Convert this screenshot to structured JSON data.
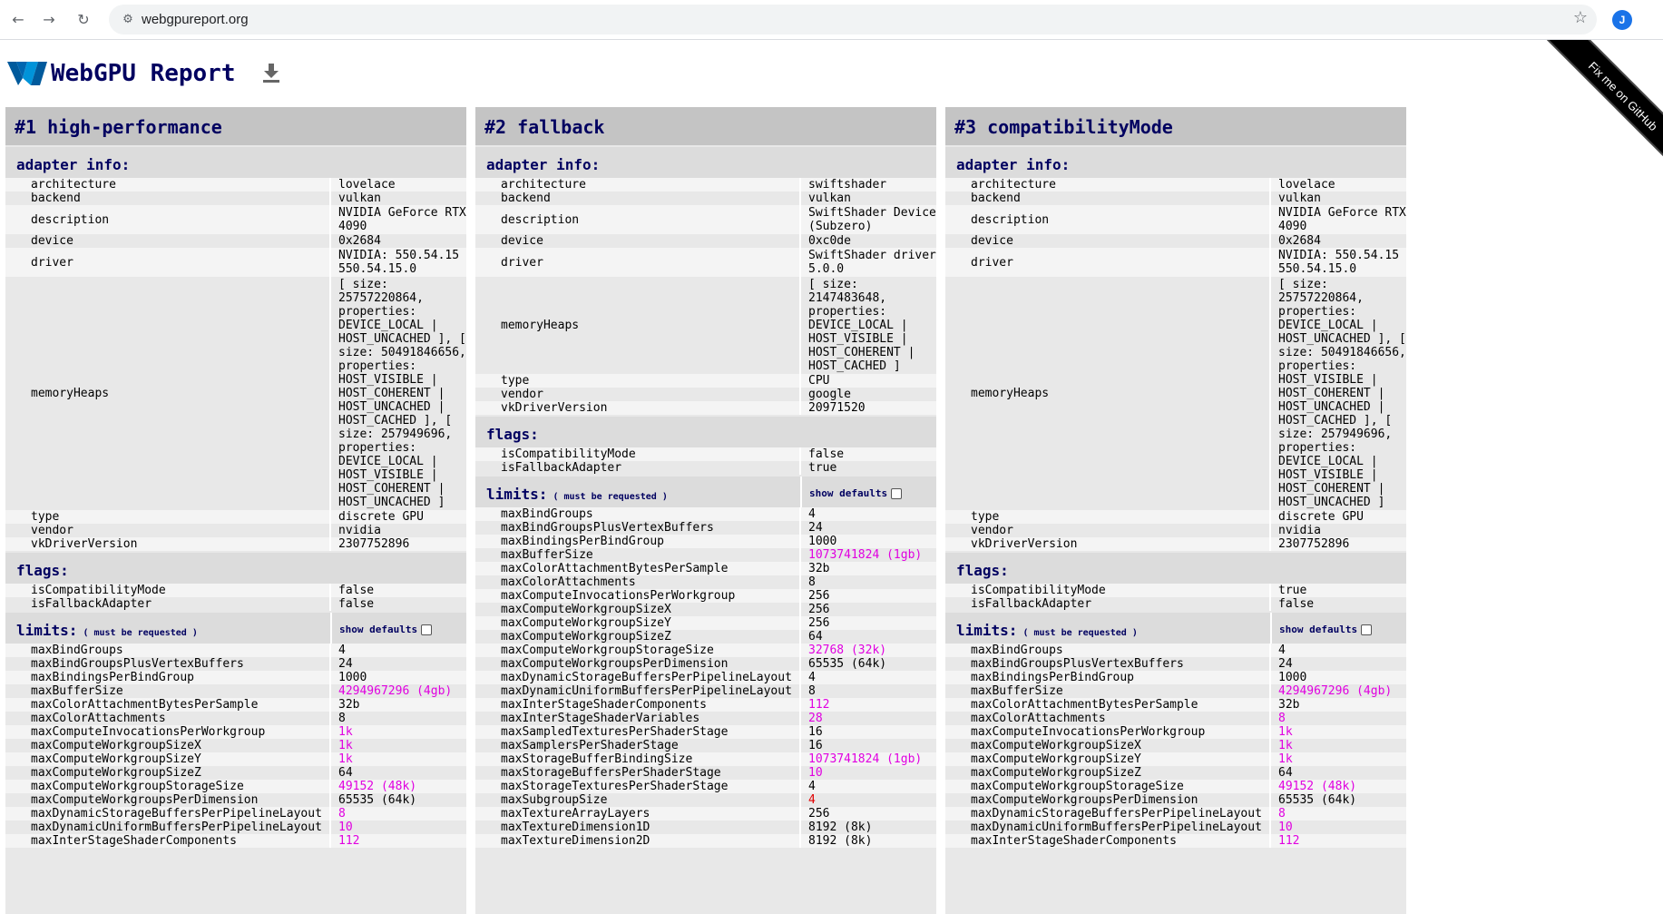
{
  "browser": {
    "url": "webgpureport.org",
    "avatar_letter": "J",
    "back_icon": "←",
    "forward_icon": "→",
    "reload_icon": "↻",
    "star_icon": "☆",
    "tune_icon": "⚙"
  },
  "ribbon": "Fix me on GitHub",
  "page": {
    "title": "WebGPU Report"
  },
  "labels": {
    "adapter_info": "adapter info:",
    "flags": "flags:",
    "limits": "limits:",
    "must_be_requested": "( must be requested )",
    "show_defaults": "show defaults"
  },
  "columns": [
    {
      "heading": "#1 high-performance",
      "adapter": [
        {
          "k": "architecture",
          "v": "lovelace"
        },
        {
          "k": "backend",
          "v": "vulkan"
        },
        {
          "k": "description",
          "v": "NVIDIA GeForce RTX 4090"
        },
        {
          "k": "device",
          "v": "0x2684"
        },
        {
          "k": "driver",
          "v": "NVIDIA: 550.54.15 550.54.15.0"
        },
        {
          "k": "memoryHeaps",
          "v": "[ size: 25757220864, properties: DEVICE_LOCAL | HOST_UNCACHED ], [ size: 50491846656, properties: HOST_VISIBLE | HOST_COHERENT | HOST_UNCACHED | HOST_CACHED ], [ size: 257949696, properties: DEVICE_LOCAL | HOST_VISIBLE | HOST_COHERENT | HOST_UNCACHED ]"
        },
        {
          "k": "type",
          "v": "discrete GPU"
        },
        {
          "k": "vendor",
          "v": "nvidia"
        },
        {
          "k": "vkDriverVersion",
          "v": "2307752896"
        }
      ],
      "flags": [
        {
          "k": "isCompatibilityMode",
          "v": "false"
        },
        {
          "k": "isFallbackAdapter",
          "v": "false"
        }
      ],
      "limits": [
        {
          "k": "maxBindGroups",
          "v": "4"
        },
        {
          "k": "maxBindGroupsPlusVertexBuffers",
          "v": "24"
        },
        {
          "k": "maxBindingsPerBindGroup",
          "v": "1000"
        },
        {
          "k": "maxBufferSize",
          "v": "4294967296 (4gb)",
          "c": "hl"
        },
        {
          "k": "maxColorAttachmentBytesPerSample",
          "v": "32b"
        },
        {
          "k": "maxColorAttachments",
          "v": "8"
        },
        {
          "k": "maxComputeInvocationsPerWorkgroup",
          "v": "1k",
          "c": "hl"
        },
        {
          "k": "maxComputeWorkgroupSizeX",
          "v": "1k",
          "c": "hl"
        },
        {
          "k": "maxComputeWorkgroupSizeY",
          "v": "1k",
          "c": "hl"
        },
        {
          "k": "maxComputeWorkgroupSizeZ",
          "v": "64"
        },
        {
          "k": "maxComputeWorkgroupStorageSize",
          "v": "49152 (48k)",
          "c": "hl"
        },
        {
          "k": "maxComputeWorkgroupsPerDimension",
          "v": "65535 (64k)"
        },
        {
          "k": "maxDynamicStorageBuffersPerPipelineLayout",
          "v": "8",
          "c": "hl"
        },
        {
          "k": "maxDynamicUniformBuffersPerPipelineLayout",
          "v": "10",
          "c": "hl"
        },
        {
          "k": "maxInterStageShaderComponents",
          "v": "112",
          "c": "hl"
        }
      ]
    },
    {
      "heading": "#2 fallback",
      "adapter": [
        {
          "k": "architecture",
          "v": "swiftshader"
        },
        {
          "k": "backend",
          "v": "vulkan"
        },
        {
          "k": "description",
          "v": "SwiftShader Device (Subzero)"
        },
        {
          "k": "device",
          "v": "0xc0de"
        },
        {
          "k": "driver",
          "v": "SwiftShader driver 5.0.0"
        },
        {
          "k": "memoryHeaps",
          "v": "[ size: 2147483648, properties: DEVICE_LOCAL | HOST_VISIBLE | HOST_COHERENT | HOST_CACHED ]"
        },
        {
          "k": "type",
          "v": "CPU"
        },
        {
          "k": "vendor",
          "v": "google"
        },
        {
          "k": "vkDriverVersion",
          "v": "20971520"
        }
      ],
      "flags": [
        {
          "k": "isCompatibilityMode",
          "v": "false"
        },
        {
          "k": "isFallbackAdapter",
          "v": "true"
        }
      ],
      "limits": [
        {
          "k": "maxBindGroups",
          "v": "4"
        },
        {
          "k": "maxBindGroupsPlusVertexBuffers",
          "v": "24"
        },
        {
          "k": "maxBindingsPerBindGroup",
          "v": "1000"
        },
        {
          "k": "maxBufferSize",
          "v": "1073741824 (1gb)",
          "c": "hl"
        },
        {
          "k": "maxColorAttachmentBytesPerSample",
          "v": "32b"
        },
        {
          "k": "maxColorAttachments",
          "v": "8"
        },
        {
          "k": "maxComputeInvocationsPerWorkgroup",
          "v": "256"
        },
        {
          "k": "maxComputeWorkgroupSizeX",
          "v": "256"
        },
        {
          "k": "maxComputeWorkgroupSizeY",
          "v": "256"
        },
        {
          "k": "maxComputeWorkgroupSizeZ",
          "v": "64"
        },
        {
          "k": "maxComputeWorkgroupStorageSize",
          "v": "32768 (32k)",
          "c": "hl"
        },
        {
          "k": "maxComputeWorkgroupsPerDimension",
          "v": "65535 (64k)"
        },
        {
          "k": "maxDynamicStorageBuffersPerPipelineLayout",
          "v": "4"
        },
        {
          "k": "maxDynamicUniformBuffersPerPipelineLayout",
          "v": "8"
        },
        {
          "k": "maxInterStageShaderComponents",
          "v": "112",
          "c": "hl"
        },
        {
          "k": "maxInterStageShaderVariables",
          "v": "28",
          "c": "hl"
        },
        {
          "k": "maxSampledTexturesPerShaderStage",
          "v": "16"
        },
        {
          "k": "maxSamplersPerShaderStage",
          "v": "16"
        },
        {
          "k": "maxStorageBufferBindingSize",
          "v": "1073741824 (1gb)",
          "c": "hl"
        },
        {
          "k": "maxStorageBuffersPerShaderStage",
          "v": "10",
          "c": "hl"
        },
        {
          "k": "maxStorageTexturesPerShaderStage",
          "v": "4"
        },
        {
          "k": "maxSubgroupSize",
          "v": "4",
          "c": "red"
        },
        {
          "k": "maxTextureArrayLayers",
          "v": "256"
        },
        {
          "k": "maxTextureDimension1D",
          "v": "8192 (8k)"
        },
        {
          "k": "maxTextureDimension2D",
          "v": "8192 (8k)"
        }
      ]
    },
    {
      "heading": "#3 compatibilityMode",
      "adapter": [
        {
          "k": "architecture",
          "v": "lovelace"
        },
        {
          "k": "backend",
          "v": "vulkan"
        },
        {
          "k": "description",
          "v": "NVIDIA GeForce RTX 4090"
        },
        {
          "k": "device",
          "v": "0x2684"
        },
        {
          "k": "driver",
          "v": "NVIDIA: 550.54.15 550.54.15.0"
        },
        {
          "k": "memoryHeaps",
          "v": "[ size: 25757220864, properties: DEVICE_LOCAL | HOST_UNCACHED ], [ size: 50491846656, properties: HOST_VISIBLE | HOST_COHERENT | HOST_UNCACHED | HOST_CACHED ], [ size: 257949696, properties: DEVICE_LOCAL | HOST_VISIBLE | HOST_COHERENT | HOST_UNCACHED ]"
        },
        {
          "k": "type",
          "v": "discrete GPU"
        },
        {
          "k": "vendor",
          "v": "nvidia"
        },
        {
          "k": "vkDriverVersion",
          "v": "2307752896"
        }
      ],
      "flags": [
        {
          "k": "isCompatibilityMode",
          "v": "true"
        },
        {
          "k": "isFallbackAdapter",
          "v": "false"
        }
      ],
      "limits": [
        {
          "k": "maxBindGroups",
          "v": "4"
        },
        {
          "k": "maxBindGroupsPlusVertexBuffers",
          "v": "24"
        },
        {
          "k": "maxBindingsPerBindGroup",
          "v": "1000"
        },
        {
          "k": "maxBufferSize",
          "v": "4294967296 (4gb)",
          "c": "hl"
        },
        {
          "k": "maxColorAttachmentBytesPerSample",
          "v": "32b"
        },
        {
          "k": "maxColorAttachments",
          "v": "8",
          "c": "hl"
        },
        {
          "k": "maxComputeInvocationsPerWorkgroup",
          "v": "1k",
          "c": "hl"
        },
        {
          "k": "maxComputeWorkgroupSizeX",
          "v": "1k",
          "c": "hl"
        },
        {
          "k": "maxComputeWorkgroupSizeY",
          "v": "1k",
          "c": "hl"
        },
        {
          "k": "maxComputeWorkgroupSizeZ",
          "v": "64"
        },
        {
          "k": "maxComputeWorkgroupStorageSize",
          "v": "49152 (48k)",
          "c": "hl"
        },
        {
          "k": "maxComputeWorkgroupsPerDimension",
          "v": "65535 (64k)"
        },
        {
          "k": "maxDynamicStorageBuffersPerPipelineLayout",
          "v": "8",
          "c": "hl"
        },
        {
          "k": "maxDynamicUniformBuffersPerPipelineLayout",
          "v": "10",
          "c": "hl"
        },
        {
          "k": "maxInterStageShaderComponents",
          "v": "112",
          "c": "hl"
        }
      ]
    }
  ]
}
